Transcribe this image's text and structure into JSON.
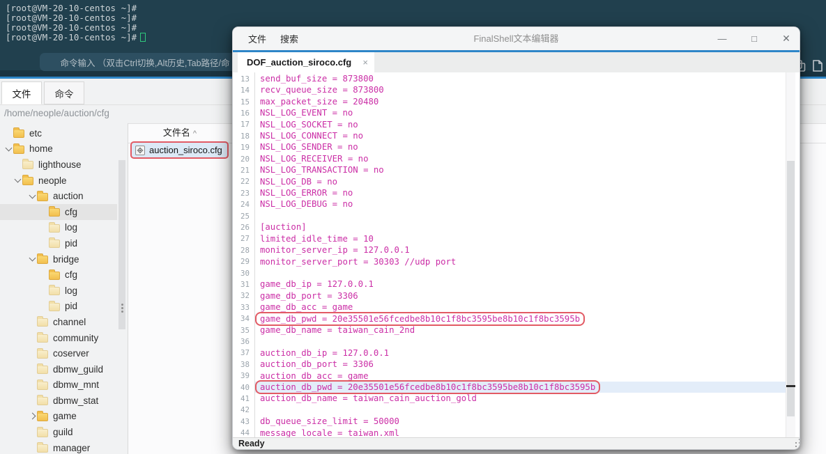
{
  "terminal": {
    "prompt_lines": [
      "[root@VM-20-10-centos ~]#",
      "[root@VM-20-10-centos ~]#",
      "[root@VM-20-10-centos ~]#",
      "[root@VM-20-10-centos ~]#"
    ],
    "command_hint": "命令输入 （双击Ctrl切换,Alt历史,Tab路径/命",
    "cursor_color": "#2fc97d"
  },
  "file_manager": {
    "tabs": [
      {
        "label": "文件",
        "active": true
      },
      {
        "label": "命令",
        "active": false
      }
    ],
    "path": "/home/neople/auction/cfg",
    "tree": [
      {
        "label": "etc",
        "depth": 0,
        "chevron": null,
        "pale": false,
        "selected": false
      },
      {
        "label": "home",
        "depth": 0,
        "chevron": "expanded",
        "pale": false,
        "selected": false
      },
      {
        "label": "lighthouse",
        "depth": 1,
        "chevron": null,
        "pale": true,
        "selected": false
      },
      {
        "label": "neople",
        "depth": 1,
        "chevron": "expanded",
        "pale": false,
        "selected": false
      },
      {
        "label": "auction",
        "depth": 2,
        "chevron": "expanded",
        "pale": false,
        "selected": false
      },
      {
        "label": "cfg",
        "depth": 3,
        "chevron": null,
        "pale": false,
        "selected": true
      },
      {
        "label": "log",
        "depth": 3,
        "chevron": null,
        "pale": true,
        "selected": false
      },
      {
        "label": "pid",
        "depth": 3,
        "chevron": null,
        "pale": true,
        "selected": false
      },
      {
        "label": "bridge",
        "depth": 2,
        "chevron": "expanded",
        "pale": false,
        "selected": false
      },
      {
        "label": "cfg",
        "depth": 3,
        "chevron": null,
        "pale": false,
        "selected": false
      },
      {
        "label": "log",
        "depth": 3,
        "chevron": null,
        "pale": true,
        "selected": false
      },
      {
        "label": "pid",
        "depth": 3,
        "chevron": null,
        "pale": true,
        "selected": false
      },
      {
        "label": "channel",
        "depth": 2,
        "chevron": null,
        "pale": true,
        "selected": false
      },
      {
        "label": "community",
        "depth": 2,
        "chevron": null,
        "pale": true,
        "selected": false
      },
      {
        "label": "coserver",
        "depth": 2,
        "chevron": null,
        "pale": true,
        "selected": false
      },
      {
        "label": "dbmw_guild",
        "depth": 2,
        "chevron": null,
        "pale": true,
        "selected": false
      },
      {
        "label": "dbmw_mnt",
        "depth": 2,
        "chevron": null,
        "pale": true,
        "selected": false
      },
      {
        "label": "dbmw_stat",
        "depth": 2,
        "chevron": null,
        "pale": true,
        "selected": false
      },
      {
        "label": "game",
        "depth": 2,
        "chevron": "collapsed",
        "pale": false,
        "selected": false
      },
      {
        "label": "guild",
        "depth": 2,
        "chevron": null,
        "pale": true,
        "selected": false
      },
      {
        "label": "manager",
        "depth": 2,
        "chevron": null,
        "pale": true,
        "selected": false
      }
    ],
    "file_list": {
      "header": "文件名",
      "sort_indicator": "^",
      "items": [
        {
          "name": "auction_siroco.cfg",
          "selected": true,
          "boxed": true
        }
      ]
    }
  },
  "editor": {
    "menus": [
      "文件",
      "搜索"
    ],
    "window_title": "FinalShell文本编辑器",
    "window_controls": [
      {
        "name": "minimize-button",
        "glyph": "—"
      },
      {
        "name": "maximize-button",
        "glyph": "□"
      },
      {
        "name": "close-button",
        "glyph": "✕"
      }
    ],
    "tab": {
      "label": "DOF_auction_siroco.cfg",
      "close_glyph": "×"
    },
    "status": "Ready",
    "code": {
      "lines": [
        {
          "no": 13,
          "text": "send_buf_size = 873800"
        },
        {
          "no": 14,
          "text": "recv_queue_size = 873800"
        },
        {
          "no": 15,
          "text": "max_packet_size = 20480"
        },
        {
          "no": 16,
          "text": "NSL_LOG_EVENT = no"
        },
        {
          "no": 17,
          "text": "NSL_LOG_SOCKET = no"
        },
        {
          "no": 18,
          "text": "NSL_LOG_CONNECT = no"
        },
        {
          "no": 19,
          "text": "NSL_LOG_SENDER = no"
        },
        {
          "no": 20,
          "text": "NSL_LOG_RECEIVER = no"
        },
        {
          "no": 21,
          "text": "NSL_LOG_TRANSACTION = no"
        },
        {
          "no": 22,
          "text": "NSL_LOG_DB = no"
        },
        {
          "no": 23,
          "text": "NSL_LOG_ERROR = no"
        },
        {
          "no": 24,
          "text": "NSL_LOG_DEBUG = no"
        },
        {
          "no": 25,
          "text": ""
        },
        {
          "no": 26,
          "text": "[auction]"
        },
        {
          "no": 27,
          "text": "limited_idle_time = 10"
        },
        {
          "no": 28,
          "text": "monitor_server_ip = 127.0.0.1"
        },
        {
          "no": 29,
          "text": "monitor_server_port = 30303 //udp port"
        },
        {
          "no": 30,
          "text": ""
        },
        {
          "no": 31,
          "text": "game_db_ip = 127.0.0.1"
        },
        {
          "no": 32,
          "text": "game_db_port = 3306"
        },
        {
          "no": 33,
          "text": "game_db_acc = game"
        },
        {
          "no": 34,
          "text": "game_db_pwd = 20e35501e56fcedbe8b10c1f8bc3595be8b10c1f8bc3595b",
          "boxed": true
        },
        {
          "no": 35,
          "text": "game_db_name = taiwan_cain_2nd"
        },
        {
          "no": 36,
          "text": ""
        },
        {
          "no": 37,
          "text": "auction_db_ip = 127.0.0.1"
        },
        {
          "no": 38,
          "text": "auction_db_port = 3306"
        },
        {
          "no": 39,
          "text": "auction_db_acc = game"
        },
        {
          "no": 40,
          "text": "auction_db_pwd = 20e35501e56fcedbe8b10c1f8bc3595be8b10c1f8bc3595b",
          "boxed": true,
          "selected": true
        },
        {
          "no": 41,
          "text": "auction_db_name = taiwan_cain_auction_gold"
        },
        {
          "no": 42,
          "text": ""
        },
        {
          "no": 43,
          "text": "db_queue_size_limit = 50000"
        },
        {
          "no": 44,
          "text": "message_locale = taiwan.xml"
        }
      ]
    }
  },
  "colors": {
    "accent_blue": "#2e86c8",
    "code_text": "#cb2ea6",
    "highlight_box_red": "#e25a64",
    "selection_blue": "#e3edf9",
    "terminal_bg": "#21404e",
    "cursor_green": "#2fc97d"
  }
}
